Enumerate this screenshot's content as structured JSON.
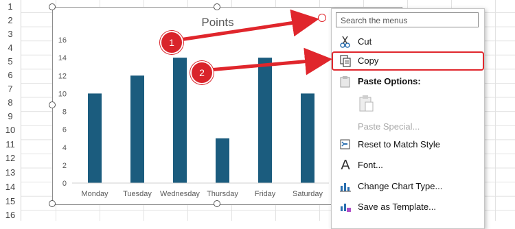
{
  "rows": [
    "1",
    "2",
    "3",
    "4",
    "5",
    "6",
    "7",
    "8",
    "9",
    "10",
    "11",
    "12",
    "13",
    "14",
    "15",
    "16"
  ],
  "chart_data": {
    "type": "bar",
    "title": "Points",
    "categories": [
      "Monday",
      "Tuesday",
      "Wednesday",
      "Thursday",
      "Friday",
      "Saturday"
    ],
    "values": [
      10,
      12,
      14,
      5,
      14,
      10
    ],
    "ylim": [
      0,
      16
    ],
    "yticks": [
      "0",
      "2",
      "4",
      "6",
      "8",
      "10",
      "12",
      "14",
      "16"
    ],
    "grid": false,
    "bar_color": "#1b5c7e"
  },
  "context_menu": {
    "search_placeholder": "Search the menus",
    "items": [
      {
        "label": "Cut",
        "icon": "scissors-icon",
        "disabled": false
      },
      {
        "label": "Copy",
        "icon": "copy-icon",
        "disabled": false
      },
      {
        "label": "Paste Options:",
        "icon": "clipboard-icon",
        "disabled": false
      },
      {
        "label": "",
        "icon": "paste-icon",
        "disabled": true
      },
      {
        "label": "Paste Special...",
        "icon": "",
        "disabled": true
      },
      {
        "label": "Reset to Match Style",
        "icon": "reset-style-icon",
        "disabled": false
      },
      {
        "label": "Font...",
        "icon": "font-icon",
        "disabled": false
      },
      {
        "label": "Change Chart Type...",
        "icon": "chart-type-icon",
        "disabled": false
      },
      {
        "label": "Save as Template...",
        "icon": "save-template-icon",
        "disabled": false
      }
    ]
  },
  "annotations": {
    "step1": "1",
    "step2": "2"
  },
  "colors": {
    "accent": "#e0262c"
  }
}
